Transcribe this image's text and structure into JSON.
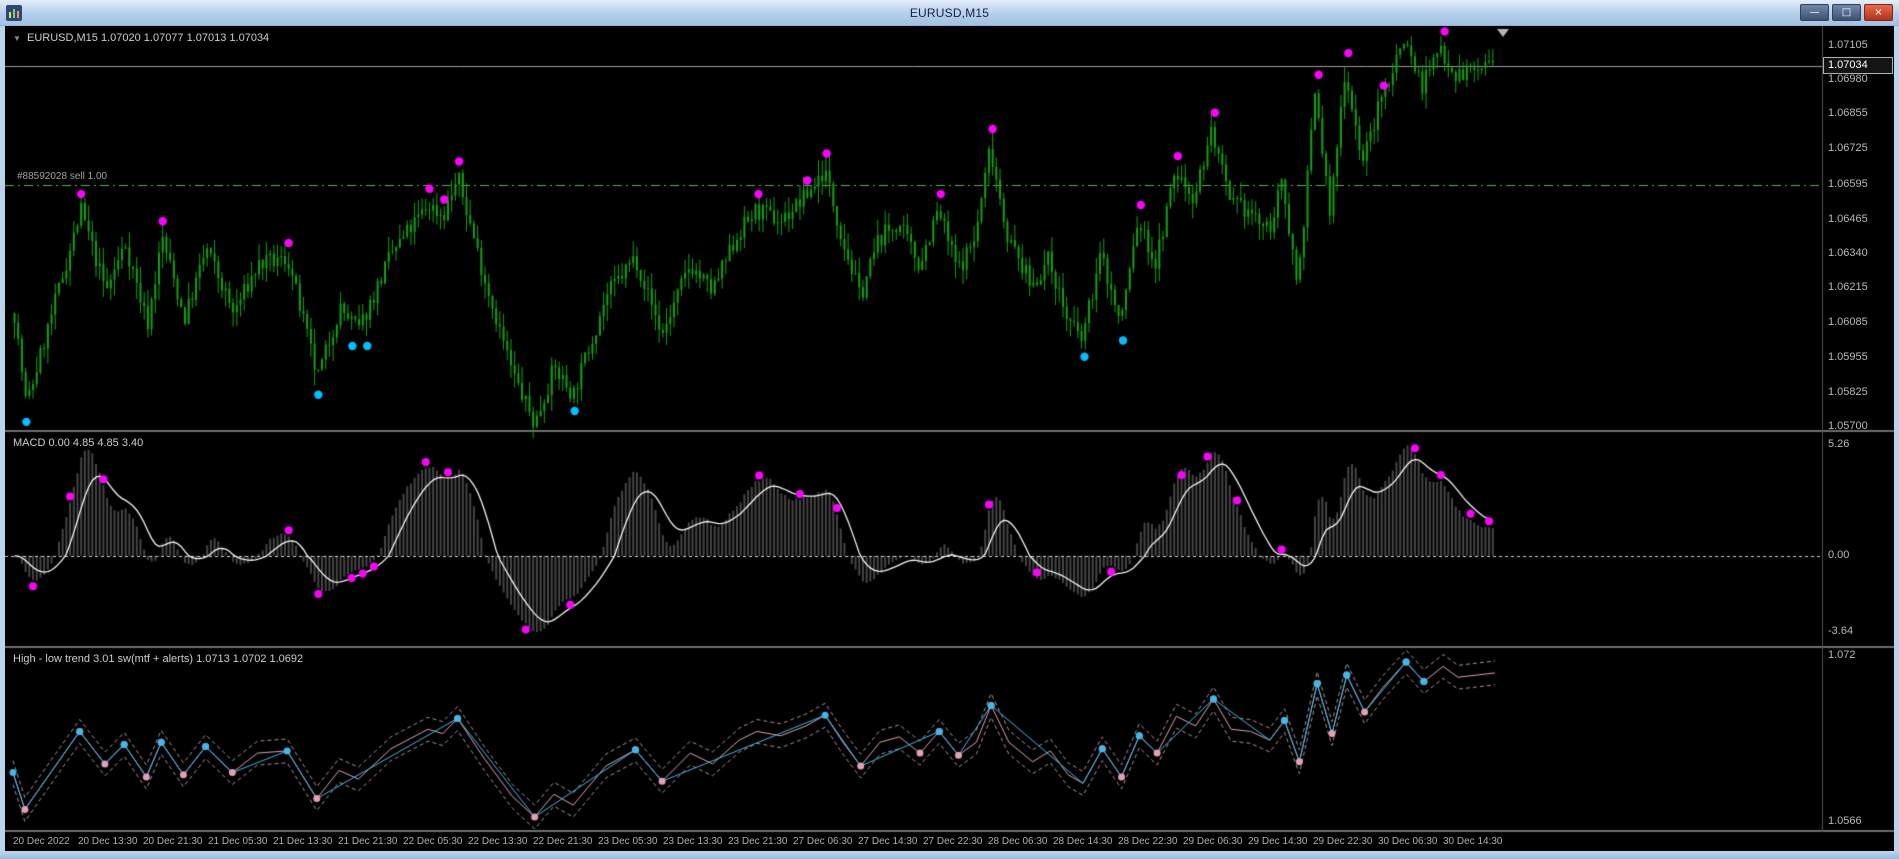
{
  "window": {
    "title": "EURUSD,M15",
    "controls": {
      "minimize": "—",
      "restore": "□",
      "close": "×"
    }
  },
  "colors": {
    "bg": "#000000",
    "candle": "#12a112",
    "magenta_dot": "#ff00ff",
    "cyan_dot": "#00bfff",
    "price_line": "#9c9c9c",
    "order_line": "#58b158",
    "separator": "#6f6f6f",
    "axis_line": "#4d4d4d",
    "macd_hist": "#454545",
    "macd_signal": "#f5f5f5",
    "macd_zero": "#cfcfcf",
    "hilo_pink": "#e0a0b5",
    "hilo_cyan": "#3fb9ea",
    "hilo_dash": "#a98f96",
    "axis_text": "#b8b8b8"
  },
  "chart_data": {
    "main": {
      "type": "candlestick",
      "label": "EURUSD,M15 1.07020 1.07077 1.07013 1.07034",
      "open": "1.07020",
      "high": "1.07077",
      "low": "1.07013",
      "close": "1.07034",
      "current_price": "1.07034",
      "current_price_value": 1.07034,
      "order_line": {
        "label": "#88592028 sell 1.00",
        "price": 1.06595
      },
      "price_ticks": [
        "1.07105",
        "1.06980",
        "1.06855",
        "1.06725",
        "1.06595",
        "1.06465",
        "1.06340",
        "1.06215",
        "1.06085",
        "1.05955",
        "1.05825",
        "1.05700"
      ],
      "scale": {
        "max": 1.0718,
        "min": 1.0569
      },
      "candle_count": 400,
      "anchors": [
        [
          0.0,
          1.0612
        ],
        [
          0.008,
          1.0578
        ],
        [
          0.045,
          1.065
        ],
        [
          0.062,
          1.062
        ],
        [
          0.075,
          1.0638
        ],
        [
          0.09,
          1.0608
        ],
        [
          0.1,
          1.064
        ],
        [
          0.115,
          1.061
        ],
        [
          0.13,
          1.0636
        ],
        [
          0.148,
          1.0612
        ],
        [
          0.165,
          1.063
        ],
        [
          0.185,
          1.0632
        ],
        [
          0.205,
          1.0588
        ],
        [
          0.22,
          1.0614
        ],
        [
          0.233,
          1.0606
        ],
        [
          0.255,
          1.0634
        ],
        [
          0.28,
          1.0652
        ],
        [
          0.29,
          1.0648
        ],
        [
          0.3,
          1.0662
        ],
        [
          0.318,
          1.0625
        ],
        [
          0.337,
          1.059
        ],
        [
          0.352,
          1.0571
        ],
        [
          0.365,
          1.0592
        ],
        [
          0.378,
          1.0582
        ],
        [
          0.4,
          1.0618
        ],
        [
          0.42,
          1.0633
        ],
        [
          0.438,
          1.0604
        ],
        [
          0.457,
          1.063
        ],
        [
          0.472,
          1.062
        ],
        [
          0.49,
          1.0642
        ],
        [
          0.502,
          1.065
        ],
        [
          0.518,
          1.0646
        ],
        [
          0.535,
          1.0655
        ],
        [
          0.548,
          1.0665
        ],
        [
          0.56,
          1.064
        ],
        [
          0.572,
          1.0618
        ],
        [
          0.585,
          1.064
        ],
        [
          0.598,
          1.0645
        ],
        [
          0.612,
          1.063
        ],
        [
          0.625,
          1.065
        ],
        [
          0.638,
          1.0628
        ],
        [
          0.65,
          1.064
        ],
        [
          0.66,
          1.0674
        ],
        [
          0.672,
          1.064
        ],
        [
          0.688,
          1.0622
        ],
        [
          0.7,
          1.0632
        ],
        [
          0.712,
          1.061
        ],
        [
          0.722,
          1.0602
        ],
        [
          0.735,
          1.0634
        ],
        [
          0.748,
          1.0608
        ],
        [
          0.76,
          1.0646
        ],
        [
          0.772,
          1.063
        ],
        [
          0.785,
          1.0664
        ],
        [
          0.798,
          1.0655
        ],
        [
          0.81,
          1.068
        ],
        [
          0.822,
          1.0652
        ],
        [
          0.835,
          1.065
        ],
        [
          0.848,
          1.0642
        ],
        [
          0.858,
          1.066
        ],
        [
          0.868,
          1.0622
        ],
        [
          0.88,
          1.0694
        ],
        [
          0.89,
          1.0648
        ],
        [
          0.9,
          1.0702
        ],
        [
          0.912,
          1.0668
        ],
        [
          0.924,
          1.069
        ],
        [
          0.94,
          1.0714
        ],
        [
          0.952,
          1.0696
        ],
        [
          0.965,
          1.071
        ],
        [
          0.975,
          1.07
        ],
        [
          1.0,
          1.0704
        ]
      ],
      "magenta_dots": [
        [
          0.045,
          1.0656
        ],
        [
          0.1,
          1.0646
        ],
        [
          0.185,
          1.0638
        ],
        [
          0.28,
          1.0658
        ],
        [
          0.29,
          1.0654
        ],
        [
          0.3,
          1.0668
        ],
        [
          0.502,
          1.0656
        ],
        [
          0.535,
          1.0661
        ],
        [
          0.548,
          1.0671
        ],
        [
          0.625,
          1.0656
        ],
        [
          0.66,
          1.068
        ],
        [
          0.76,
          1.0652
        ],
        [
          0.785,
          1.067
        ],
        [
          0.81,
          1.0686
        ],
        [
          0.88,
          1.07
        ],
        [
          0.9,
          1.0708
        ],
        [
          0.924,
          1.0696
        ],
        [
          0.94,
          1.072
        ],
        [
          0.965,
          1.0716
        ]
      ],
      "cyan_dots": [
        [
          0.008,
          1.0572
        ],
        [
          0.205,
          1.0582
        ],
        [
          0.228,
          1.06
        ],
        [
          0.238,
          1.06
        ],
        [
          0.378,
          1.0576
        ],
        [
          0.722,
          1.0596
        ],
        [
          0.748,
          1.0602
        ]
      ]
    },
    "macd": {
      "type": "bar+line",
      "label": "MACD 0.00 4.85 4.85 3.40",
      "ticks": [
        {
          "value": 5.26,
          "label": "5.26"
        },
        {
          "value": 0,
          "label": "0.00"
        },
        {
          "value": -3.64,
          "label": "-3.64"
        }
      ],
      "scale": {
        "max": 5.9,
        "min": -4.3
      },
      "dots": [
        {
          "x": 0.038,
          "s": 1
        },
        {
          "x": 0.06,
          "s": 1
        },
        {
          "x": 0.185,
          "s": 1
        },
        {
          "x": 0.278,
          "s": 1
        },
        {
          "x": 0.293,
          "s": 1
        },
        {
          "x": 0.503,
          "s": 1
        },
        {
          "x": 0.532,
          "s": 1
        },
        {
          "x": 0.556,
          "s": 1
        },
        {
          "x": 0.66,
          "s": 1
        },
        {
          "x": 0.692,
          "s": 1
        },
        {
          "x": 0.806,
          "s": 1
        },
        {
          "x": 0.828,
          "s": 1
        },
        {
          "x": 0.858,
          "s": 1
        },
        {
          "x": 0.948,
          "s": 1
        },
        {
          "x": 0.965,
          "s": 1
        },
        {
          "x": 0.985,
          "s": 1
        },
        {
          "x": 0.997,
          "s": 1
        },
        {
          "x": 0.012,
          "s": -1
        },
        {
          "x": 0.205,
          "s": -1
        },
        {
          "x": 0.228,
          "s": -1
        },
        {
          "x": 0.236,
          "s": -1
        },
        {
          "x": 0.243,
          "s": -1
        },
        {
          "x": 0.345,
          "s": -1
        },
        {
          "x": 0.375,
          "s": -1
        },
        {
          "x": 0.742,
          "s": -1
        },
        {
          "x": 0.79,
          "s": -1
        }
      ]
    },
    "hilo": {
      "type": "line",
      "label": "High - low trend 3.01 sw(mtf + alerts) 1.0713 1.0702 1.0692",
      "ticks": [
        {
          "value": 1.072,
          "label": "1.072"
        },
        {
          "value": 1.0566,
          "label": "1.0566"
        }
      ],
      "scale": {
        "max": 1.0727,
        "min": 1.0559
      }
    },
    "time_axis": [
      "20 Dec 2022",
      "20 Dec 13:30",
      "20 Dec 21:30",
      "21 Dec 05:30",
      "21 Dec 13:30",
      "21 Dec 21:30",
      "22 Dec 05:30",
      "22 Dec 13:30",
      "22 Dec 21:30",
      "23 Dec 05:30",
      "23 Dec 13:30",
      "23 Dec 21:30",
      "27 Dec 06:30",
      "27 Dec 14:30",
      "27 Dec 22:30",
      "28 Dec 06:30",
      "28 Dec 14:30",
      "28 Dec 22:30",
      "29 Dec 06:30",
      "29 Dec 14:30",
      "29 Dec 22:30",
      "30 Dec 06:30",
      "30 Dec 14:30"
    ]
  }
}
